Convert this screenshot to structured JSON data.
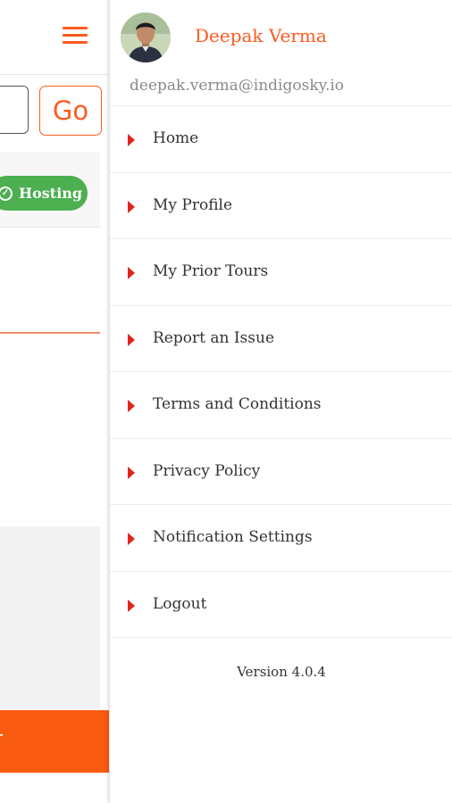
{
  "background_page": {
    "search_button_label": "Go",
    "status_badge_label": "Hosting",
    "bottom_bar_text": "r",
    "colors": {
      "accent": "#ff5a1f",
      "badge": "#4caf50",
      "bottom_bar": "#f85a10"
    }
  },
  "drawer": {
    "user": {
      "name": "Deepak Verma",
      "email": "deepak.verma@indigosky.io",
      "avatar_icon": "user-photo"
    },
    "menu": [
      {
        "label": "Home",
        "icon": "caret-right-icon"
      },
      {
        "label": "My Profile",
        "icon": "caret-right-icon"
      },
      {
        "label": "My Prior Tours",
        "icon": "caret-right-icon"
      },
      {
        "label": "Report an Issue",
        "icon": "caret-right-icon"
      },
      {
        "label": "Terms and Conditions",
        "icon": "caret-right-icon"
      },
      {
        "label": "Privacy Policy",
        "icon": "caret-right-icon"
      },
      {
        "label": "Notification Settings",
        "icon": "caret-right-icon"
      },
      {
        "label": "Logout",
        "icon": "caret-right-icon"
      }
    ],
    "version_text": "Version 4.0.4",
    "colors": {
      "name": "#ff5a1f",
      "caret": "#e0261a"
    }
  }
}
